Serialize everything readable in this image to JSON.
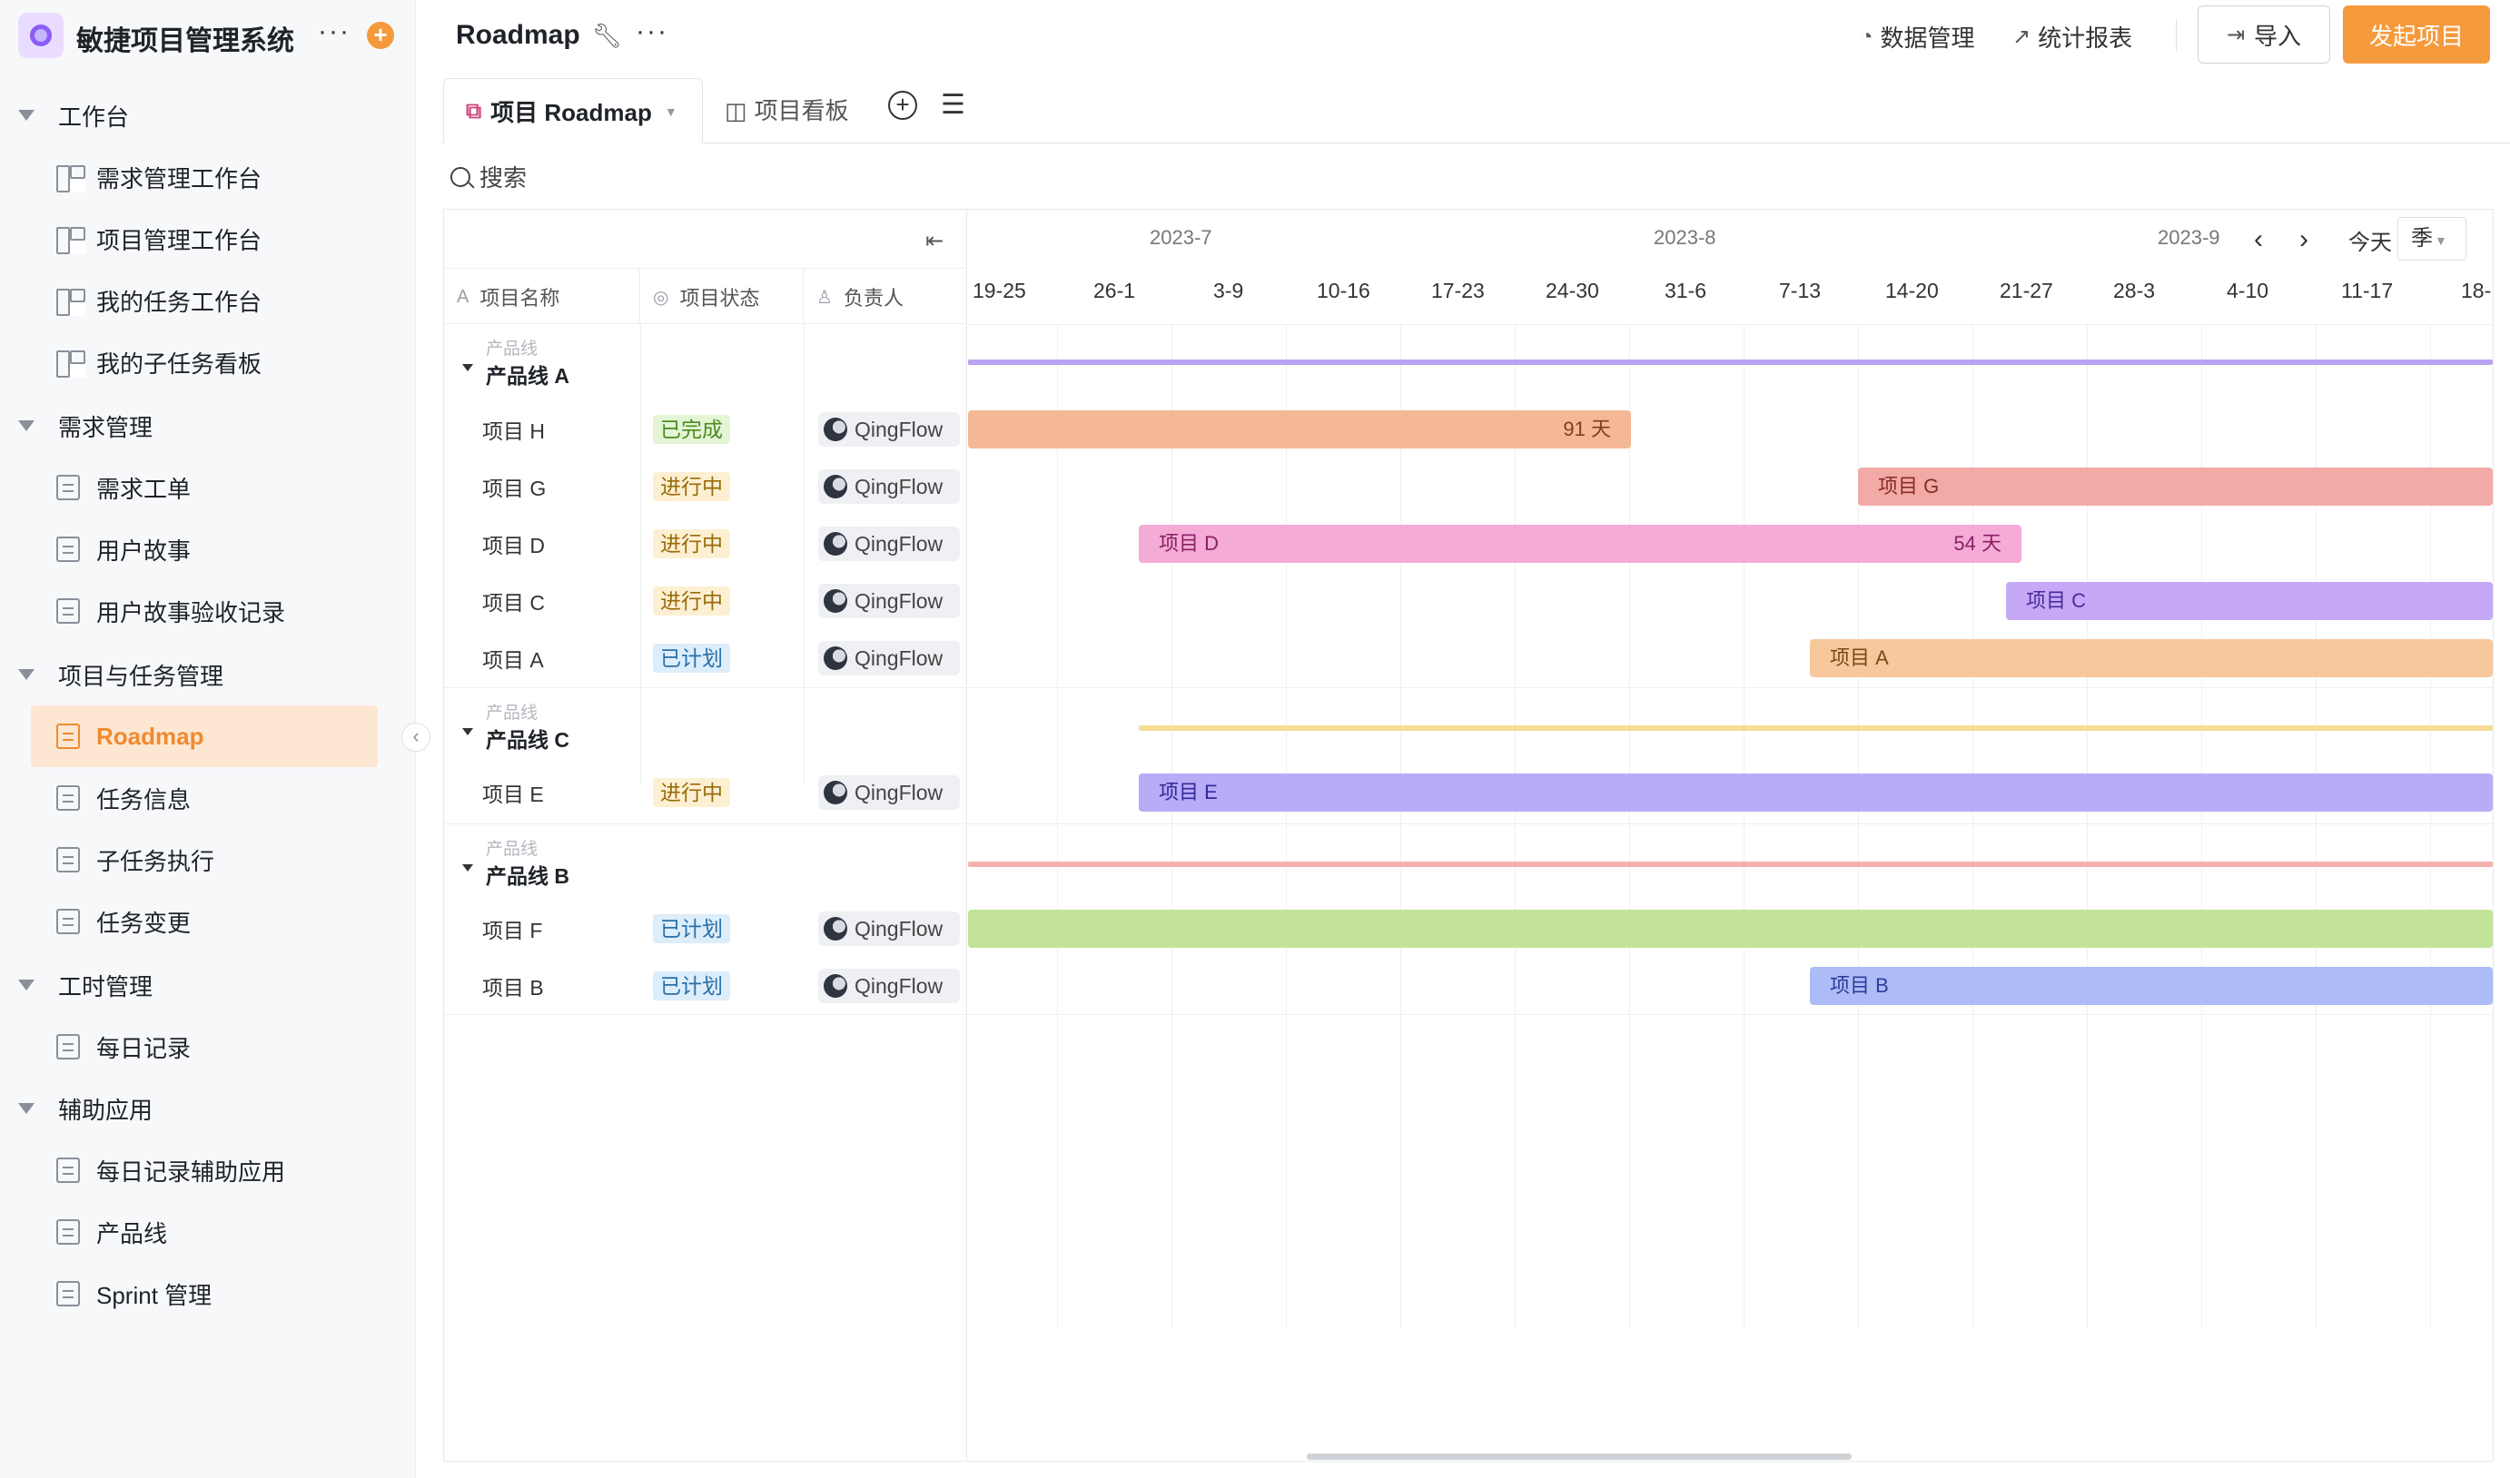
{
  "app": {
    "title": "敏捷项目管理系统",
    "more": "···",
    "add": "+"
  },
  "sidebar": {
    "groups": [
      {
        "label": "工作台",
        "items": [
          "需求管理工作台",
          "项目管理工作台",
          "我的任务工作台",
          "我的子任务看板"
        ]
      },
      {
        "label": "需求管理",
        "items": [
          "需求工单",
          "用户故事",
          "用户故事验收记录"
        ]
      },
      {
        "label": "项目与任务管理",
        "items": [
          "Roadmap",
          "任务信息",
          "子任务执行",
          "任务变更"
        ]
      },
      {
        "label": "工时管理",
        "items": [
          "每日记录"
        ]
      },
      {
        "label": "辅助应用",
        "items": [
          "每日记录辅助应用",
          "产品线",
          "Sprint 管理"
        ]
      }
    ],
    "active_item": "Roadmap",
    "collapse_glyph": "‹"
  },
  "header": {
    "title": "Roadmap",
    "more": "···",
    "data_mgmt": "数据管理",
    "reports": "统计报表",
    "import": "导入",
    "start": "发起项目"
  },
  "tabs": {
    "roadmap": "项目 Roadmap",
    "board": "项目看板",
    "add": "+",
    "list": "☰"
  },
  "toolbar": {
    "search": "搜索"
  },
  "table": {
    "collapse_glyph": "⇤",
    "headers": {
      "name": "项目名称",
      "status": "项目状态",
      "owner": "负责人"
    },
    "groups": [
      {
        "small": "产品线",
        "name": "产品线 A",
        "rows": [
          {
            "name": "项目 H",
            "status": "已完成",
            "owner": "QingFlow"
          },
          {
            "name": "项目 G",
            "status": "进行中",
            "owner": "QingFlow"
          },
          {
            "name": "项目 D",
            "status": "进行中",
            "owner": "QingFlow"
          },
          {
            "name": "项目 C",
            "status": "进行中",
            "owner": "QingFlow"
          },
          {
            "name": "项目 A",
            "status": "已计划",
            "owner": "QingFlow"
          }
        ]
      },
      {
        "small": "产品线",
        "name": "产品线 C",
        "rows": [
          {
            "name": "项目 E",
            "status": "进行中",
            "owner": "QingFlow"
          }
        ]
      },
      {
        "small": "产品线",
        "name": "产品线 B",
        "rows": [
          {
            "name": "项目 F",
            "status": "已计划",
            "owner": "QingFlow"
          },
          {
            "name": "项目 B",
            "status": "已计划",
            "owner": "QingFlow"
          }
        ]
      }
    ]
  },
  "timeline": {
    "months": [
      "2023-7",
      "2023-8",
      "2023-9"
    ],
    "weeks": [
      "19-25",
      "26-1",
      "3-9",
      "10-16",
      "17-23",
      "24-30",
      "31-6",
      "7-13",
      "14-20",
      "21-27",
      "28-3",
      "4-10",
      "11-17",
      "18-"
    ],
    "today": "今天",
    "zoom": "季",
    "prev": "‹",
    "next": "›",
    "bars": [
      {
        "row": "项目 H",
        "label": "",
        "duration": "91 天",
        "color": "#f4b896"
      },
      {
        "row": "项目 G",
        "label": "项目 G",
        "duration": "",
        "color": "#f2aaa6"
      },
      {
        "row": "项目 D",
        "label": "项目 D",
        "duration": "54 天",
        "color": "#f4acd6"
      },
      {
        "row": "项目 C",
        "label": "项目 C",
        "duration": "",
        "color": "#c6a9f6"
      },
      {
        "row": "项目 A",
        "label": "项目 A",
        "duration": "",
        "color": "#f6c89c"
      },
      {
        "row": "项目 E",
        "label": "项目 E",
        "duration": "",
        "color": "#b8acf6"
      },
      {
        "row": "项目 F",
        "label": "",
        "duration": "",
        "color": "#c3e39a"
      },
      {
        "row": "项目 B",
        "label": "项目 B",
        "duration": "",
        "color": "#adbcf6"
      }
    ],
    "group_line_colors": [
      "#b9a4f4",
      "#f7dc96",
      "#f3b1ae"
    ]
  }
}
